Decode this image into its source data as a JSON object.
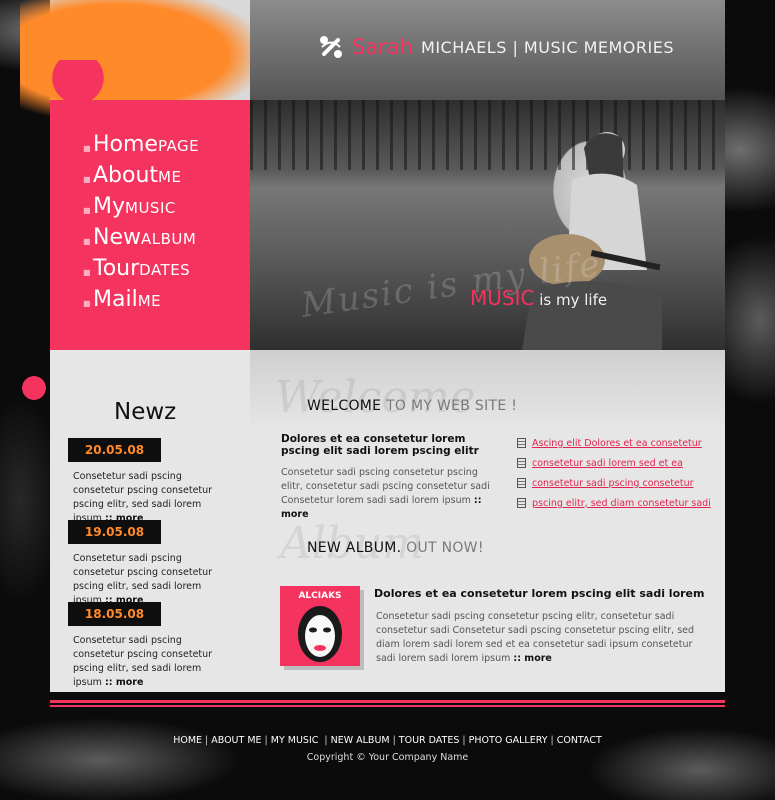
{
  "header": {
    "brand_first": "Sarah",
    "brand_rest": "MICHAELS | MUSIC MEMORIES"
  },
  "menu": [
    {
      "big": "Home",
      "small": "PAGE"
    },
    {
      "big": "About",
      "small": "ME"
    },
    {
      "big": "My",
      "small": "MUSIC"
    },
    {
      "big": "New",
      "small": "ALBUM"
    },
    {
      "big": "Tour",
      "small": "DATES"
    },
    {
      "big": "Mail",
      "small": "ME"
    }
  ],
  "hero": {
    "script_text": "Music is my life",
    "caption_highlight": "MUSIC",
    "caption_rest": " is my life"
  },
  "news": {
    "title": "Newz",
    "items": [
      {
        "date": "20.05.08",
        "text": "Consetetur sadi pscing consetetur pscing consetetur pscing elitr, sed sadi lorem ipsum",
        "more": ":: more"
      },
      {
        "date": "19.05.08",
        "text": "Consetetur sadi pscing consetetur pscing consetetur pscing elitr, sed sadi lorem ipsum",
        "more": ":: more"
      },
      {
        "date": "18.05.08",
        "text": "Consetetur sadi pscing consetetur pscing consetetur pscing elitr, sed sadi lorem ipsum",
        "more": ":: more"
      }
    ]
  },
  "welcome": {
    "ghost": "Welcome",
    "heading_dark": "WELCOME",
    "heading_light": " TO MY WEB SITE !",
    "subtitle": "Dolores et ea consetetur lorem pscing elit sadi lorem pscing elitr",
    "body": "Consetetur sadi pscing consetetur pscing elitr, consetetur sadi pscing consetetur sadi Consetetur lorem sadi sadi lorem ipsum",
    "more": ":: more",
    "links": [
      "Ascing elit Dolores et ea consetetur",
      "consetetur sadi lorem sed  et ea",
      "consetetur sadi pscing consetetur",
      "pscing elitr, sed diam consetetur sadi"
    ]
  },
  "album": {
    "ghost": "Album",
    "heading_dark": "NEW ALBUM.",
    "heading_light": " OUT NOW!",
    "cover_text": "ALCIAKS",
    "title": "Dolores et ea consetetur lorem pscing elit sadi lorem",
    "body": "Consetetur sadi pscing consetetur pscing elitr, consetetur sadi consetetur sadi Consetetur sadi pscing consetetur pscing elitr, sed diam lorem sadi lorem sed  et ea consetetur sadi ipsum consetetur sadi lorem sadi lorem ipsum",
    "more": ":: more"
  },
  "footer": {
    "nav": [
      "HOME",
      "ABOUT ME",
      "MY MUSIC ",
      "NEW ALBUM",
      "TOUR DATES",
      "PHOTO GALLERY",
      "CONTACT"
    ],
    "copyright": "Copyright © Your Company Name"
  },
  "colors": {
    "accent_pink": "#f4335f",
    "accent_orange": "#ff8a2a",
    "background": "#0b0b0b",
    "content_bg": "#e6e6e6"
  }
}
